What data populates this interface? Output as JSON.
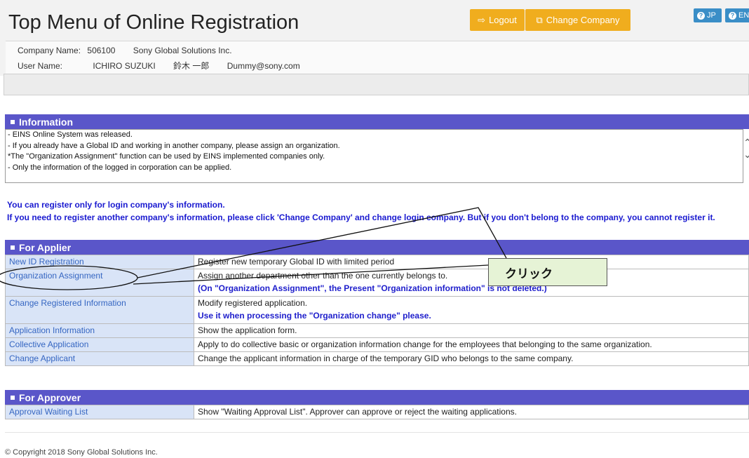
{
  "header": {
    "title": "Top Menu of Online Registration",
    "logout_label": "Logout",
    "change_company_label": "Change Company",
    "lang_jp": "JP",
    "lang_en": "EN"
  },
  "user_info": {
    "company_label": "Company Name:",
    "company_code": "506100",
    "company_name": "Sony Global Solutions Inc.",
    "user_label": "User Name:",
    "user_name_en": "ICHIRO SUZUKI",
    "user_name_jp": "鈴木 一郎",
    "email": "Dummy@sony.com"
  },
  "information": {
    "heading": "Information",
    "lines": [
      "- EINS Online System was released.",
      "- If you already have a Global ID and working in another company, please assign an organization.",
      "*The \"Organization Assignment\" function can be used by EINS implemented companies only.",
      "- Only the information of the logged in corporation can be applied."
    ]
  },
  "notice": {
    "line1": "You can register only for login company's information.",
    "line2": "If you need to register another company's information, please click 'Change Company' and change login company. But if you don't belong to the company, you cannot register it."
  },
  "applier": {
    "heading": "For Applier",
    "rows": [
      {
        "link": "New ID Registration",
        "desc": "Register new temporary Global ID with limited period",
        "note": ""
      },
      {
        "link": "Organization Assignment",
        "desc": "Assign another department other than the one currently belongs to.",
        "note": "(On \"Organization Assignment\", the Present \"Organization information\" is not deleted.)"
      },
      {
        "link": "Change Registered Information",
        "desc": "Modify registered application.",
        "note": "Use it when processing the \"Organization change\" please."
      },
      {
        "link": "Application Information",
        "desc": "Show the application form.",
        "note": ""
      },
      {
        "link": "Collective Application",
        "desc": "Apply to do collective basic or organization information change for the employees that belonging to the same organization.",
        "note": ""
      },
      {
        "link": "Change Applicant",
        "desc": "Change the applicant information in charge of the temporary GID who belongs to the same company.",
        "note": ""
      }
    ]
  },
  "approver": {
    "heading": "For Approver",
    "rows": [
      {
        "link": "Approval Waiting List",
        "desc": "Show \"Waiting Approval List\". Approver can approve or reject the waiting applications."
      }
    ]
  },
  "annotation": {
    "text": "クリック"
  },
  "footer": {
    "copyright": "© Copyright 2018 Sony Global Solutions Inc."
  },
  "colors": {
    "section_header": "#5a56c9",
    "button": "#f0ad1e",
    "lang_button": "#3a8ec7",
    "link": "#3566c2",
    "notice": "#1a1ad0"
  },
  "icons": {
    "logout": "sign-out-icon",
    "change_company": "external-link-icon",
    "lang": "question-circle-icon"
  }
}
